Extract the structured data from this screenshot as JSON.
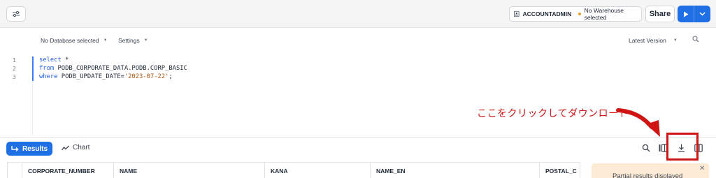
{
  "toolbar": {
    "role": "ACCOUNTADMIN",
    "warehouse": "No Warehouse selected",
    "share_label": "Share"
  },
  "editor_bar": {
    "database": "No Database selected",
    "settings": "Settings",
    "version": "Latest Version"
  },
  "code": {
    "line_numbers": [
      "1",
      "2",
      "3"
    ],
    "line1_kw": "select",
    "line1_rest": " *",
    "line2_kw": "from",
    "line2_rest": " PODB_CORPORATE_DATA.PODB.CORP_BASIC",
    "line3_kw": "where",
    "line3_rest": " PODB_UPDATE_DATE=",
    "line3_str": "'2023-07-22'",
    "line3_end": ";"
  },
  "annotation": {
    "text": "ここをクリックしてダウンロード",
    "color": "#d01414"
  },
  "results_bar": {
    "results_label": "Results",
    "chart_label": "Chart"
  },
  "table": {
    "columns": [
      "CORPORATE_NUMBER",
      "NAME",
      "KANA",
      "NAME_EN",
      "POSTAL_C"
    ]
  },
  "toast": {
    "message": "Partial results displayed"
  },
  "colors": {
    "accent": "#1f6fe5",
    "annotation_red": "#d01414",
    "toast_bg": "#fdebd5"
  }
}
